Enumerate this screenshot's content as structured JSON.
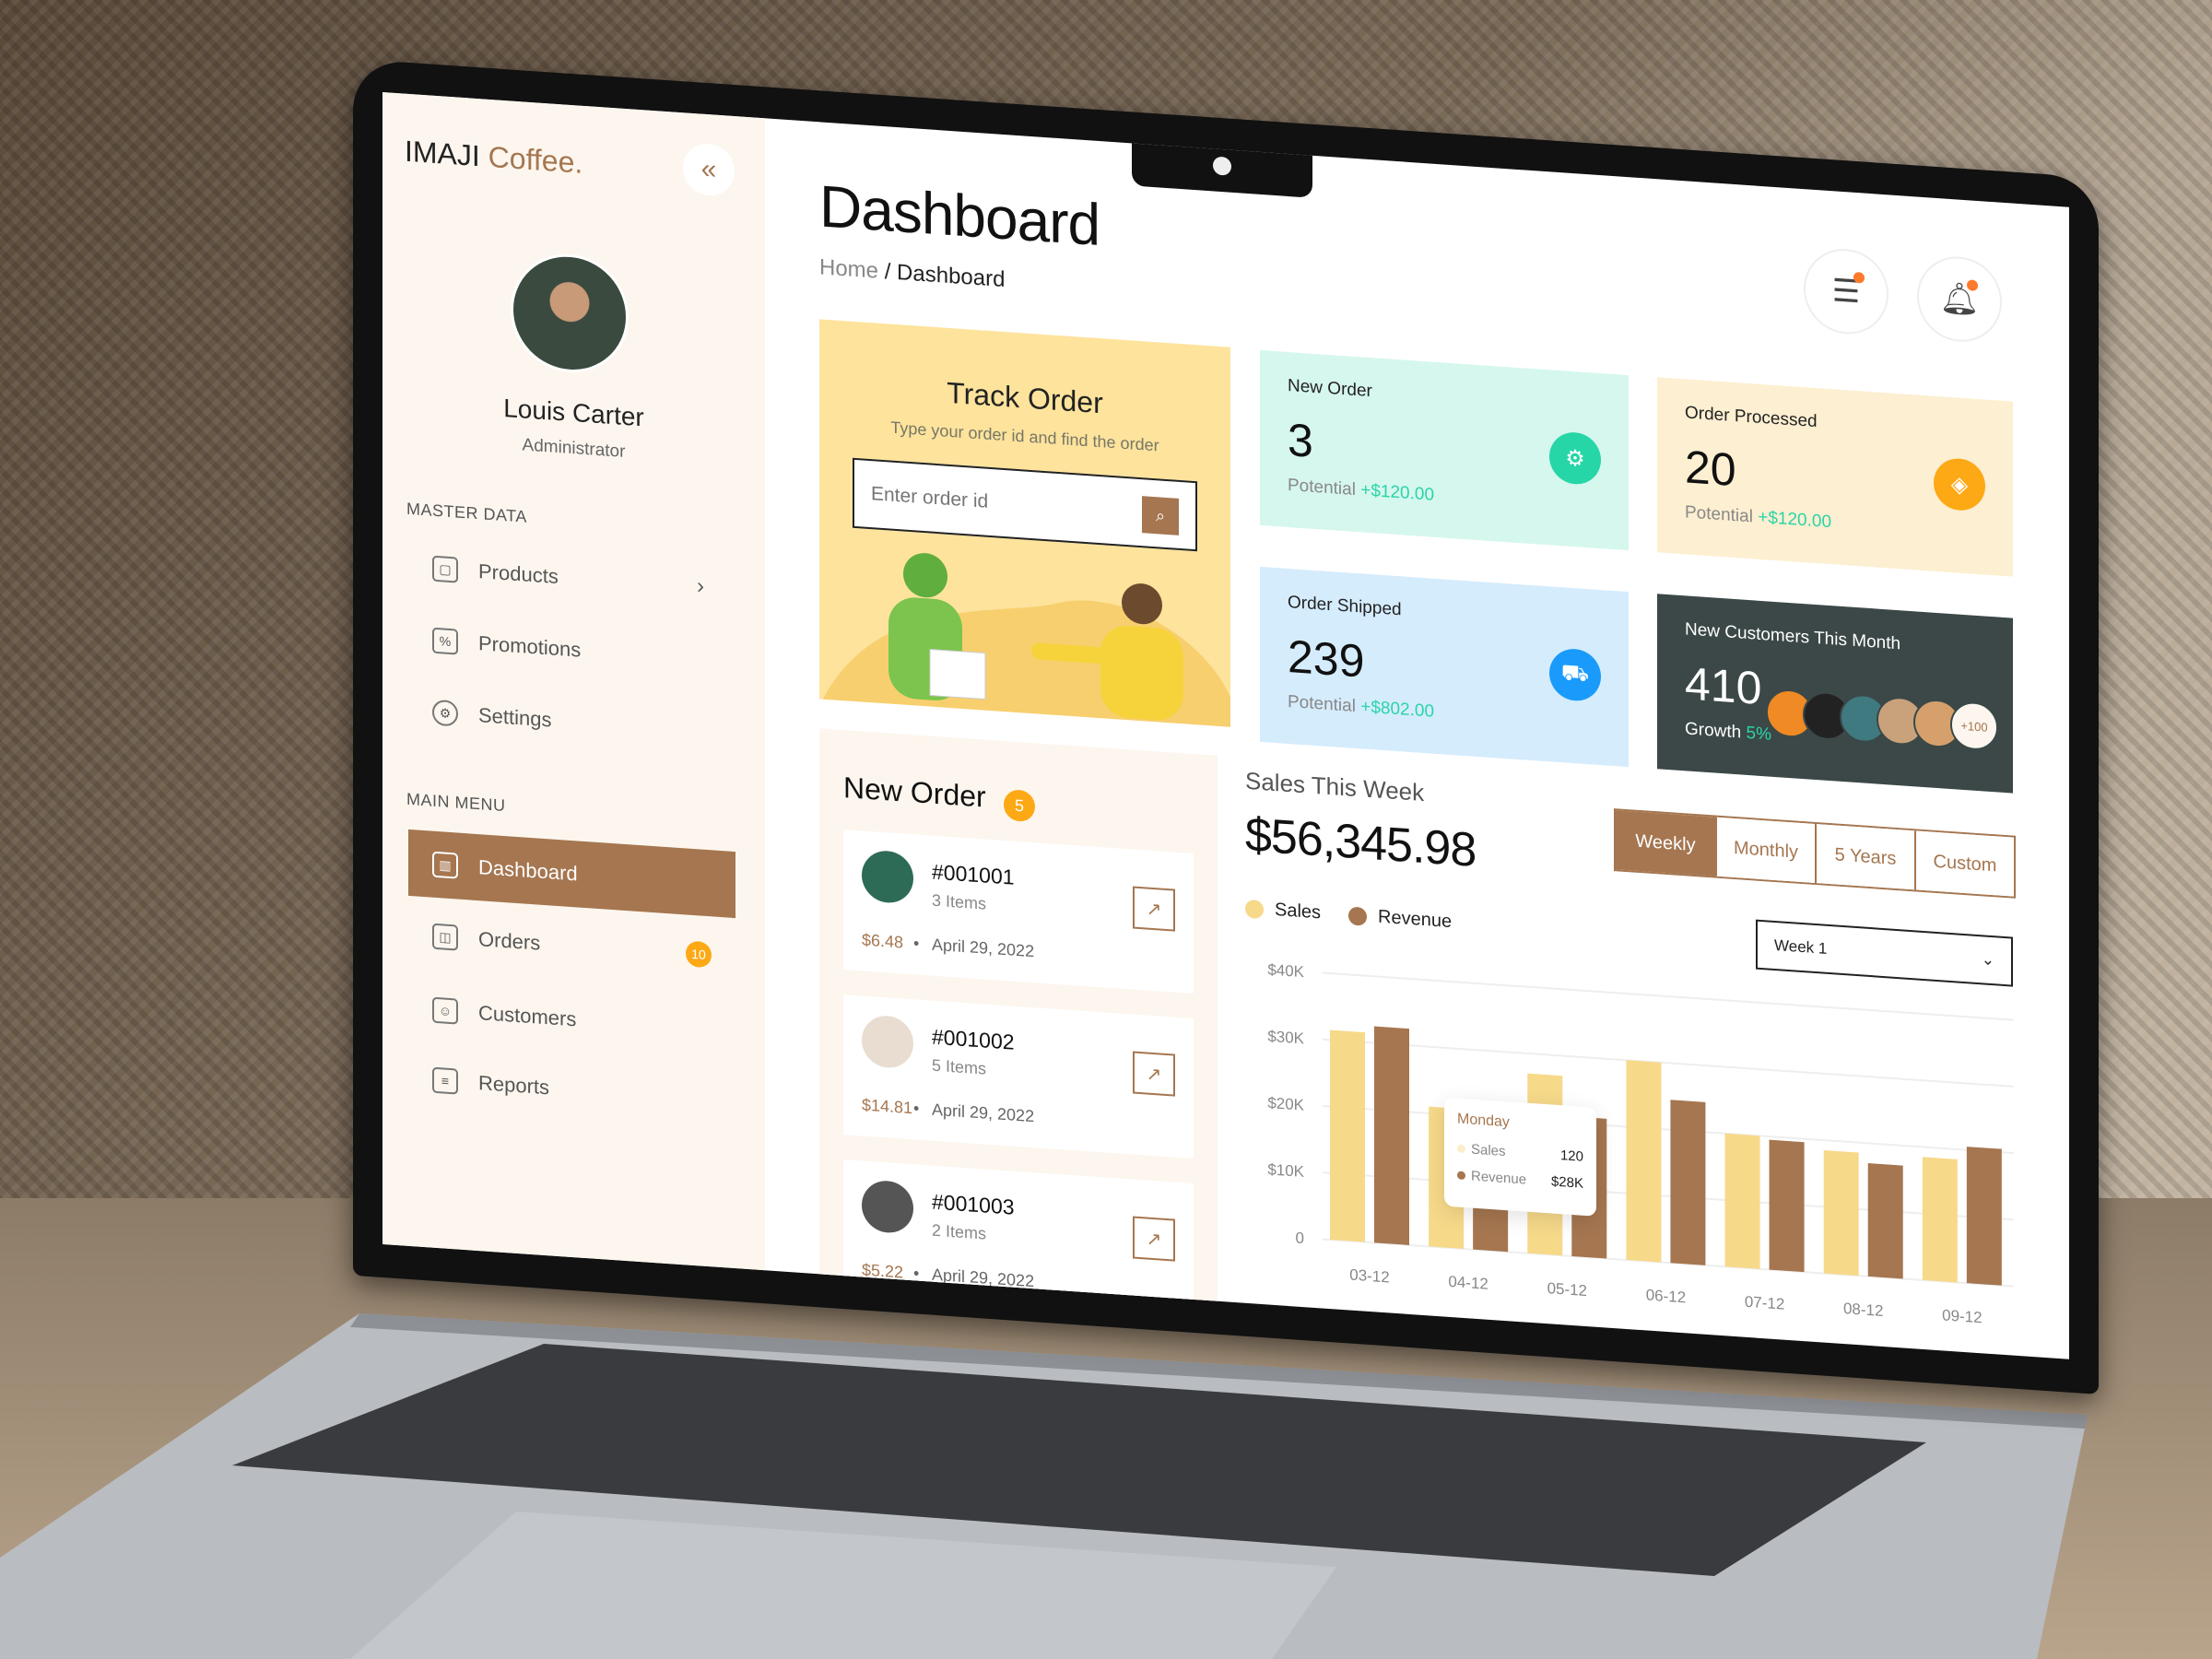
{
  "brand": {
    "name": "IMAJI",
    "suffix": "Coffee."
  },
  "user": {
    "name": "Louis Carter",
    "role": "Administrator"
  },
  "sidebar": {
    "master_heading": "MASTER DATA",
    "master_items": [
      {
        "label": "Products",
        "icon": "box-icon"
      },
      {
        "label": "Promotions",
        "icon": "discount-icon"
      },
      {
        "label": "Settings",
        "icon": "gear-icon"
      }
    ],
    "main_heading": "MAIN MENU",
    "main_items": [
      {
        "label": "Dashboard",
        "icon": "bar-chart-icon",
        "active": true
      },
      {
        "label": "Orders",
        "icon": "basket-icon",
        "badge": "10"
      },
      {
        "label": "Customers",
        "icon": "user-card-icon"
      },
      {
        "label": "Reports",
        "icon": "document-icon"
      }
    ]
  },
  "header": {
    "title": "Dashboard",
    "breadcrumb": [
      "Home",
      "Dashboard"
    ],
    "separator": "/"
  },
  "track": {
    "title": "Track Order",
    "subtitle": "Type your order id and find the order",
    "placeholder": "Enter order id"
  },
  "stats": [
    {
      "label": "New Order",
      "value": "3",
      "potential_label": "Potential",
      "potential": "+$120.00",
      "color": "#d6f7ee",
      "icon_color": "#26d6a7"
    },
    {
      "label": "Order Processed",
      "value": "20",
      "potential_label": "Potential",
      "potential": "+$120.00",
      "color": "#fdefd1",
      "icon_color": "#fda915"
    },
    {
      "label": "Order Shipped",
      "value": "239",
      "potential_label": "Potential",
      "potential": "+$802.00",
      "color": "#d5ecfd",
      "icon_color": "#1a9bfb"
    },
    {
      "label": "New Customers This Month",
      "value": "410",
      "growth_label": "Growth",
      "growth": "5%",
      "more": "+100"
    }
  ],
  "new_orders": {
    "title": "New Order",
    "count": "5",
    "items": [
      {
        "id": "#001001",
        "qty": "3 Items",
        "price": "$6.48",
        "date": "April 29, 2022"
      },
      {
        "id": "#001002",
        "qty": "5 Items",
        "price": "$14.81",
        "date": "April 29, 2022"
      },
      {
        "id": "#001003",
        "qty": "2 Items",
        "price": "$5.22",
        "date": "April 29, 2022"
      }
    ]
  },
  "sales": {
    "title": "Sales This Week",
    "amount": "$56,345.98",
    "tabs": [
      "Weekly",
      "Monthly",
      "5 Years",
      "Custom"
    ],
    "active_tab": "Weekly",
    "select": "Week 1",
    "tooltip": {
      "day": "Monday",
      "sales_label": "Sales",
      "sales": "120",
      "revenue_label": "Revenue",
      "revenue": "$28K"
    }
  },
  "chart_data": {
    "type": "bar",
    "categories": [
      "03-12",
      "04-12",
      "05-12",
      "06-12",
      "07-12",
      "08-12",
      "09-12"
    ],
    "series": [
      {
        "name": "Sales",
        "color": "#f7d98a",
        "values": [
          31.5,
          21,
          27,
          30,
          20,
          18.5,
          18.5
        ]
      },
      {
        "name": "Revenue",
        "color": "#a57650",
        "values": [
          32.5,
          12,
          21,
          24.5,
          19.5,
          17,
          20.5
        ]
      }
    ],
    "yticks": [
      "0",
      "$10K",
      "$20K",
      "$30K",
      "$40K"
    ],
    "ylim": [
      0,
      40
    ],
    "unit": "thousand USD",
    "grid": true,
    "legend": "top-left"
  }
}
